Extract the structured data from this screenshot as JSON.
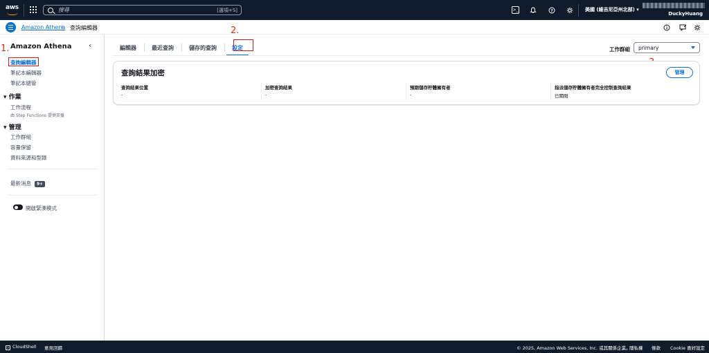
{
  "topnav": {
    "logo_text": "aws",
    "search_placeholder": "搜尋",
    "search_shortcut": "[選項+S]",
    "region": "美國 (維吉尼亞州北部) ▾",
    "username": "DuckyHuang"
  },
  "breadcrumb": {
    "service": "Amazon Athena",
    "separator": "›",
    "current": "查詢編輯器"
  },
  "sidebar": {
    "title": "Amazon Athena",
    "collapse": "‹",
    "items": [
      {
        "label": "查詢編輯器"
      },
      {
        "label": "筆記本編輯器"
      },
      {
        "label": "筆記本總管"
      }
    ],
    "section_jobs": "▾ 作業",
    "workflow": {
      "label": "工作流程",
      "sub": "由 Step Functions 提供支援"
    },
    "section_admin": "▾ 管理",
    "admin_items": [
      {
        "label": "工作群組"
      },
      {
        "label": "容量保留"
      },
      {
        "label": "資料來源和型錄"
      }
    ],
    "news_label": "最新消息",
    "news_badge": "9+",
    "dense_mode": "開啟緊湊模式"
  },
  "annotations": {
    "a1": "1.",
    "a2": "2.",
    "a3": "3."
  },
  "tabs": [
    {
      "label": "編輯器"
    },
    {
      "label": "最近查詢"
    },
    {
      "label": "儲存的查詢"
    },
    {
      "label": "設定"
    }
  ],
  "workgroup": {
    "label": "工作群組",
    "value": "primary"
  },
  "card": {
    "title": "查詢結果加密",
    "manage_button": "管理",
    "fields": [
      {
        "key": "查詢結果位置",
        "value": "-"
      },
      {
        "key": "加密查詢結果",
        "value": "-"
      },
      {
        "key": "預期儲存貯體擁有者",
        "value": "-"
      },
      {
        "key": "指派儲存貯體擁有者完全控制查詢結果",
        "value": "已關閉"
      }
    ]
  },
  "footer": {
    "cloudshell": "CloudShell",
    "feedback": "意見回饋",
    "copyright": "© 2025, Amazon Web Services, Inc. 或其關係企業。",
    "privacy": "隱私權",
    "terms": "條款",
    "cookies": "Cookie 喜好設定"
  },
  "colors": {
    "nav_bg": "#0f1b2a",
    "accent": "#0972d3",
    "annotation_red": "#d91515"
  }
}
